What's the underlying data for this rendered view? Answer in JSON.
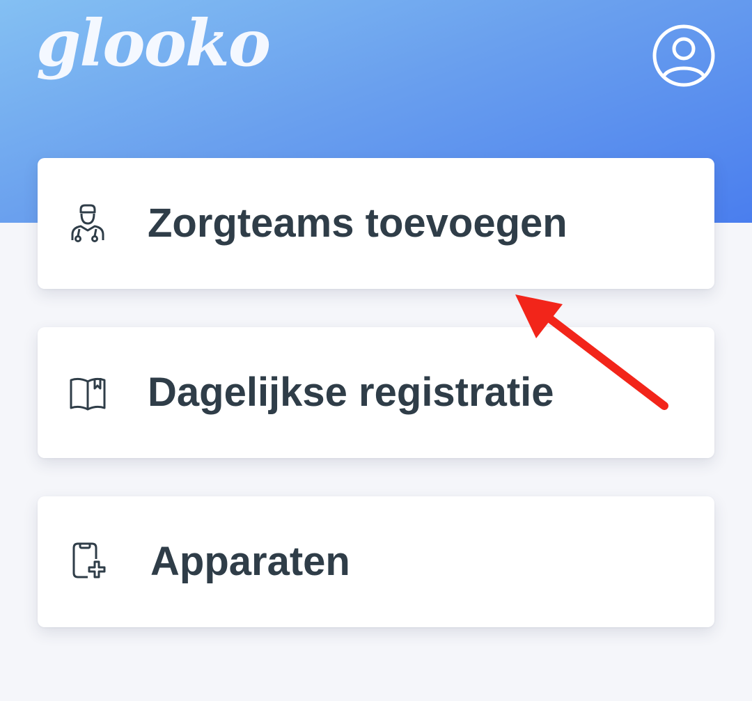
{
  "header": {
    "logo_text": "glooko",
    "profile_icon": "user-circle-icon",
    "background_gradient": [
      "#84c0f3",
      "#4a7eee"
    ]
  },
  "menu": {
    "items": [
      {
        "label": "Zorgteams toevoegen",
        "icon": "doctor-icon"
      },
      {
        "label": "Dagelijkse registratie",
        "icon": "logbook-icon"
      },
      {
        "label": "Apparaten",
        "icon": "device-add-icon"
      }
    ]
  },
  "annotation": {
    "type": "arrow",
    "color": "#f2251a",
    "points_to": "Zorgteams toevoegen"
  },
  "colors": {
    "page_background": "#f5f6fa",
    "card_background": "#ffffff",
    "label_text": "#2f3d48"
  }
}
